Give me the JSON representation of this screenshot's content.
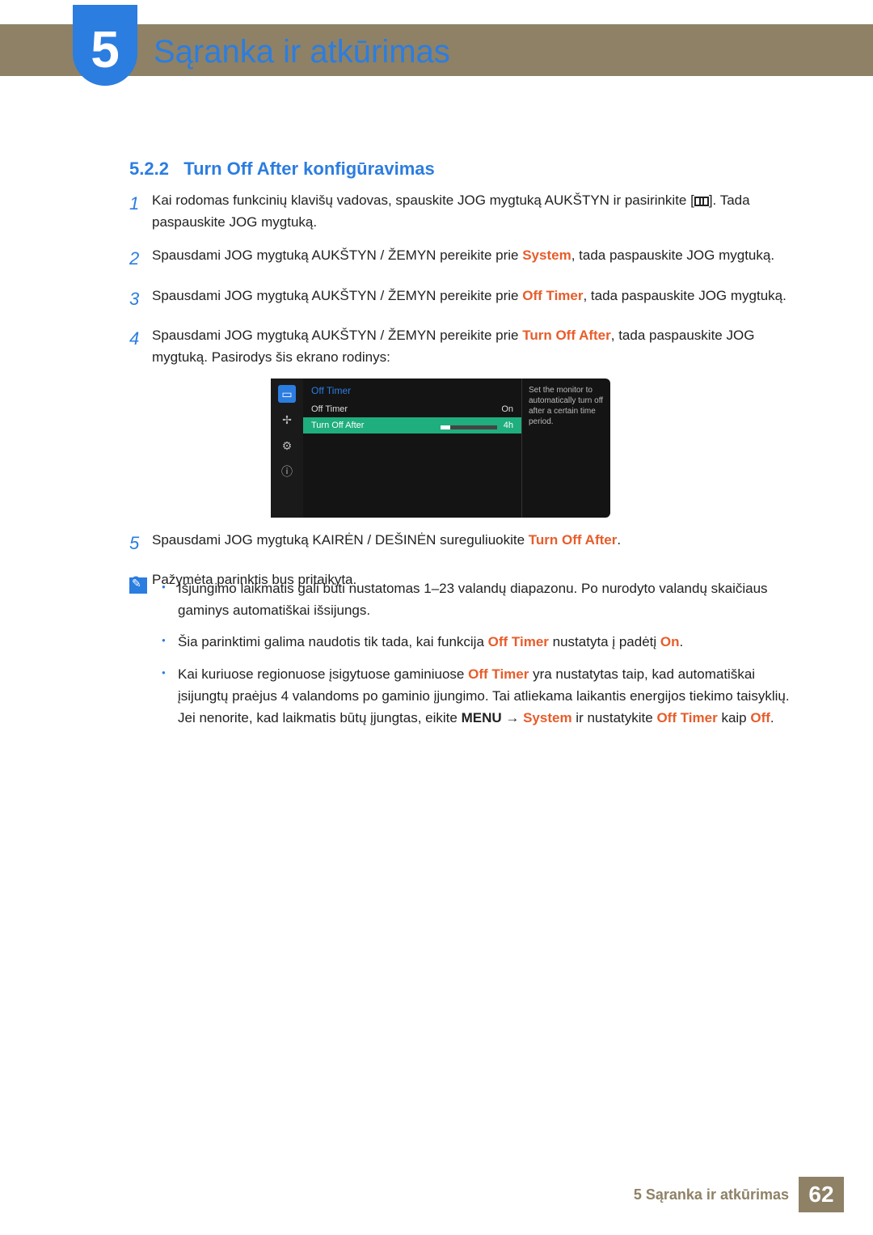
{
  "header": {
    "chapter_number": "5",
    "chapter_title": "Sąranka ir atkūrimas"
  },
  "section": {
    "number": "5.2.2",
    "title": "Turn Off After konfigūravimas"
  },
  "steps": {
    "s1a": "Kai rodomas funkcinių klavišų vadovas, spauskite JOG mygtuką AUKŠTYN ir pasirinkite [",
    "s1b": "]. Tada paspauskite JOG mygtuką.",
    "s2a": "Spausdami JOG mygtuką AUKŠTYN / ŽEMYN pereikite prie ",
    "s2hl": "System",
    "s2b": ", tada paspauskite JOG mygtuką.",
    "s3a": "Spausdami JOG mygtuką AUKŠTYN / ŽEMYN pereikite prie ",
    "s3hl": "Off Timer",
    "s3b": ", tada paspauskite JOG mygtuką.",
    "s4a": "Spausdami JOG mygtuką AUKŠTYN / ŽEMYN pereikite prie ",
    "s4hl": "Turn Off After",
    "s4b": ", tada paspauskite JOG mygtuką. Pasirodys šis ekrano rodinys:",
    "s5a": "Spausdami JOG mygtuką KAIRĖN / DEŠINĖN sureguliuokite ",
    "s5hl": "Turn Off After",
    "s5b": ".",
    "s6": "Pažymėta parinktis bus pritaikyta."
  },
  "osd": {
    "title": "Off Timer",
    "row1_label": "Off Timer",
    "row1_value": "On",
    "row2_label": "Turn Off After",
    "row2_value": "4h",
    "desc": "Set the monitor to automatically turn off after a certain time period."
  },
  "notes": {
    "n1": "Išjungimo laikmatis gali būti nustatomas 1–23 valandų diapazonu. Po nurodyto valandų skaičiaus gaminys automatiškai išsijungs.",
    "n2a": "Šia parinktimi galima naudotis tik tada, kai funkcija ",
    "n2hl1": "Off Timer",
    "n2b": " nustatyta į padėtį ",
    "n2hl2": "On",
    "n2c": ".",
    "n3a": "Kai kuriuose regionuose įsigytuose gaminiuose ",
    "n3hl1": "Off Timer",
    "n3b": " yra nustatytas taip, kad automatiškai įsijungtų praėjus 4 valandoms po gaminio įjungimo. Tai atliekama laikantis energijos tiekimo taisyklių. Jei nenorite, kad laikmatis būtų įjungtas, eikite ",
    "n3bold": "MENU",
    "n3arrow": " → ",
    "n3hl2": "System",
    "n3c": " ir nustatykite ",
    "n3hl3": "Off Timer",
    "n3d": " kaip ",
    "n3hl4": "Off",
    "n3e": "."
  },
  "footer": {
    "label": "5 Sąranka ir atkūrimas",
    "page": "62"
  }
}
